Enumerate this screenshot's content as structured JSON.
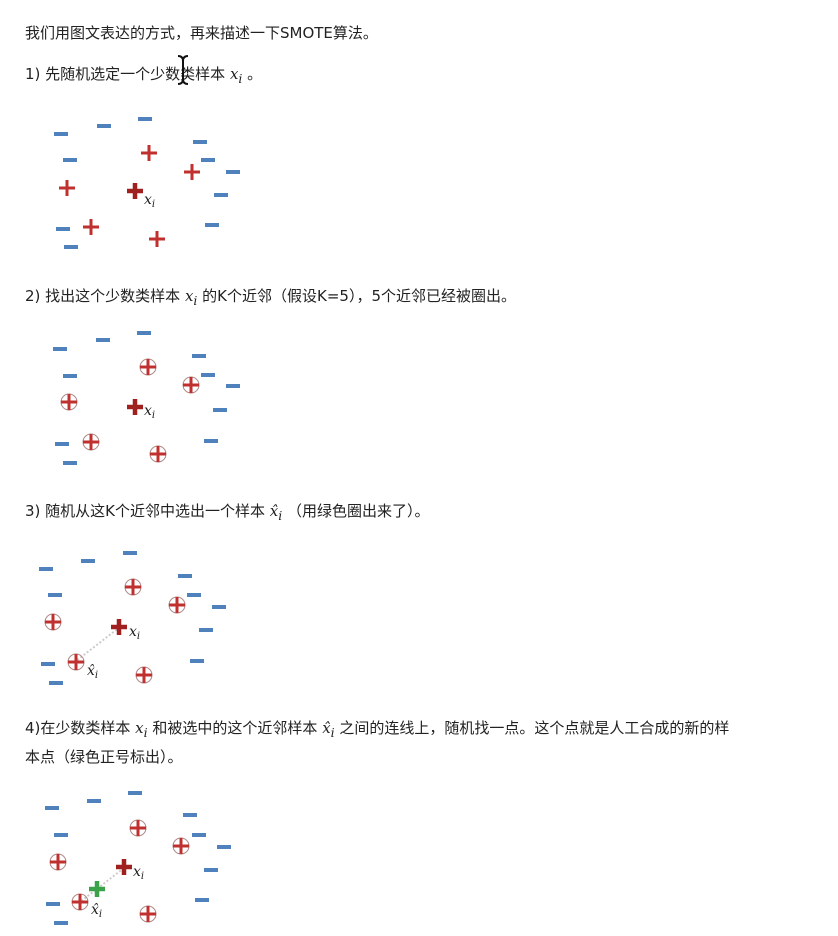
{
  "intro": "我们用图文表达的方式，再来描述一下SMOTE算法。",
  "step1": {
    "prefix": "1) 先随机选定一个少数类样本 ",
    "var": "x",
    "sub": "i",
    "suffix": " 。"
  },
  "step2": {
    "prefix": "2) 找出这个少数类样本 ",
    "var": "x",
    "sub": "i",
    "suffix": " 的K个近邻（假设K=5），5个近邻已经被圈出。"
  },
  "step3": {
    "prefix": "3) 随机从这K个近邻中选出一个样本 ",
    "var": "x̂",
    "sub": "i",
    "suffix": " （用绿色圈出来了）。"
  },
  "step4": {
    "line1_a": "4)在少数类样本 ",
    "var1": "x",
    "sub1": "i",
    "line1_b": " 和被选中的这个近邻样本 ",
    "var2": "x̂",
    "sub2": "i",
    "line1_c": " 之间的连线上，随机找一点。这个点就是人工合成的新的样",
    "line2": "本点（绿色正号标出）。"
  },
  "labels": {
    "xi": "x",
    "xi_sub": "i",
    "xhat": "x̂",
    "xhat_sub": "i"
  },
  "colors": {
    "minus": "#4f81bd",
    "plus": "#c0302e",
    "plus_dark": "#a02020",
    "synthetic": "#3aa34a",
    "circle": "#b08888"
  }
}
